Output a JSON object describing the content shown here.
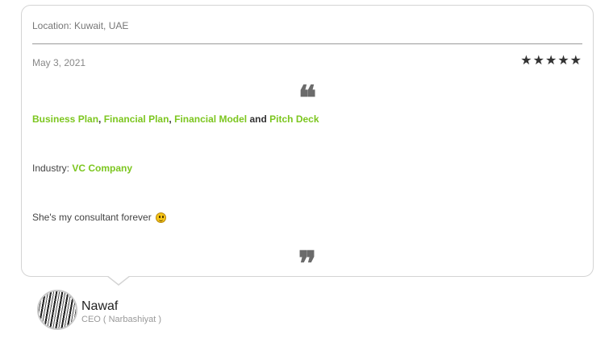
{
  "review": {
    "location": "Location: Kuwait, UAE",
    "date": "May 3, 2021",
    "rating": 5,
    "stars": "★★★★★",
    "open_quote": "❝",
    "close_quote": "❞",
    "services": {
      "item1": "Business Plan",
      "sep1": ",",
      "item2": "Financial Plan",
      "sep2": ",",
      "item3": "Financial Model",
      "conj": "and",
      "item4": "Pitch Deck"
    },
    "industry": {
      "label": "Industry:",
      "value": "VC Company"
    },
    "comment": "She's my consultant forever",
    "comment_emoji": "smiley-emoji-icon"
  },
  "author": {
    "name": "Nawaf",
    "role": "CEO ( Narbashiyat )"
  },
  "colors": {
    "accent_green": "#7cc61f",
    "border": "#d4d4d4",
    "quote_gray": "#6b6b6b"
  }
}
